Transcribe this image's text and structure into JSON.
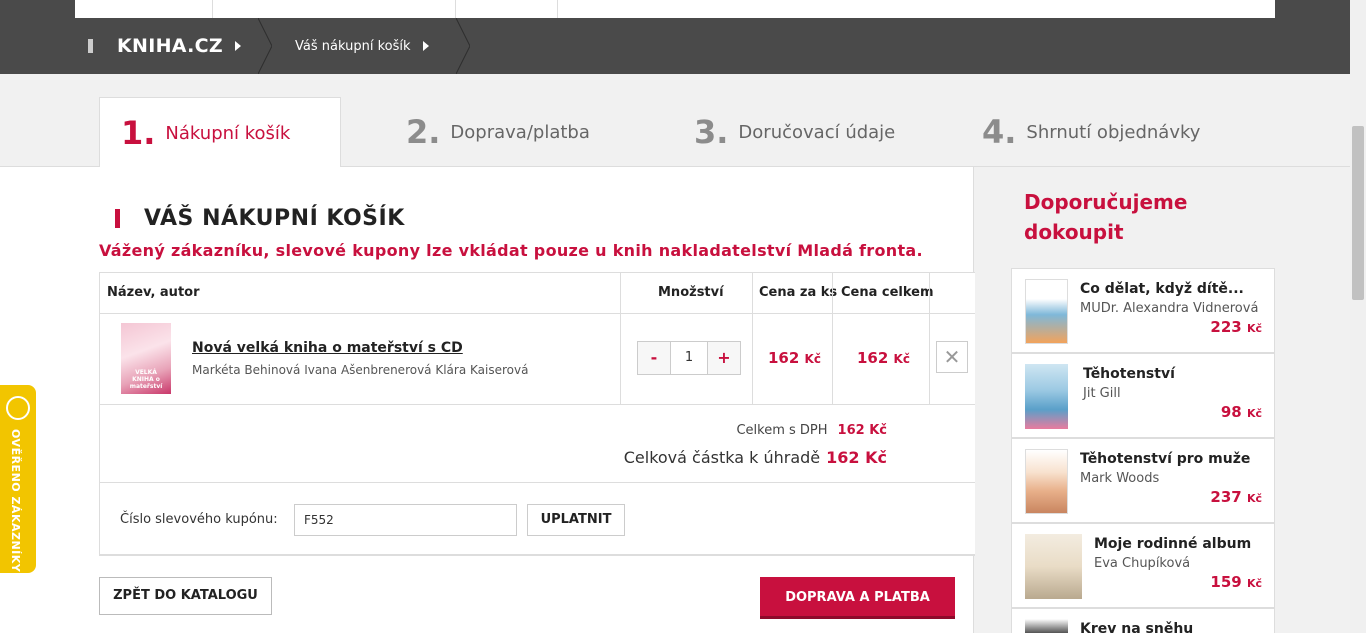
{
  "header": {
    "logo": "KNIHA.CZ",
    "breadcrumb": "Váš nákupní košík"
  },
  "steps": [
    {
      "num": "1.",
      "label": "Nákupní košík"
    },
    {
      "num": "2.",
      "label": "Doprava/platba"
    },
    {
      "num": "3.",
      "label": "Doručovací údaje"
    },
    {
      "num": "4.",
      "label": "Shrnutí objednávky"
    }
  ],
  "cart": {
    "title": "VÁŠ NÁKUPNÍ KOŠÍK",
    "notice": "Vážený zákazníku, slevové kupony lze vkládat pouze u knih nakladatelství Mladá fronta.",
    "columns": {
      "name": "Název, autor",
      "qty": "Množství",
      "unit_price": "Cena za ks",
      "total_price": "Cena celkem"
    },
    "items": [
      {
        "cover_text": "VELKÁ KNIHA o mateřství",
        "title": "Nová velká kniha o mateřství s CD",
        "authors": "Markéta Behinová  Ivana Ašenbrenerová  Klára Kaiserová",
        "qty": "1",
        "minus": "-",
        "plus": "+",
        "unit_price": "162",
        "total_price": "162",
        "currency": "Kč",
        "remove": "✕"
      }
    ],
    "totals": {
      "vat_label": "Celkem s DPH",
      "vat_value": "162 Kč",
      "grand_label": "Celková částka k úhradě",
      "grand_value": "162 Kč"
    },
    "coupon": {
      "label": "Číslo slevového kupónu:",
      "value": "F552",
      "apply": "UPLATNIT"
    },
    "back_button": "ZPĚT DO KATALOGU",
    "next_button": "DOPRAVA A PLATBA"
  },
  "sidebar": {
    "title": "Doporučujeme dokoupit",
    "items": [
      {
        "title": "Co dělat, když dítě...",
        "author": "MUDr. Alexandra Vidnerová",
        "price": "223",
        "currency": "Kč"
      },
      {
        "title": "Těhotenství",
        "author": "Jit Gill",
        "price": "98",
        "currency": "Kč"
      },
      {
        "title": "Těhotenství pro muže",
        "author": "Mark Woods",
        "price": "237",
        "currency": "Kč"
      },
      {
        "title": "Moje rodinné album",
        "author": "Eva Chupíková",
        "price": "159",
        "currency": "Kč"
      },
      {
        "title": "Krev na sněhu",
        "author": "",
        "price": "",
        "currency": ""
      }
    ]
  },
  "badge": {
    "text": "OVĚŘENO ZÁKAZNÍKY"
  },
  "colors": {
    "accent": "#c8103e",
    "header": "#4a4a4a",
    "badge": "#f2c500"
  }
}
